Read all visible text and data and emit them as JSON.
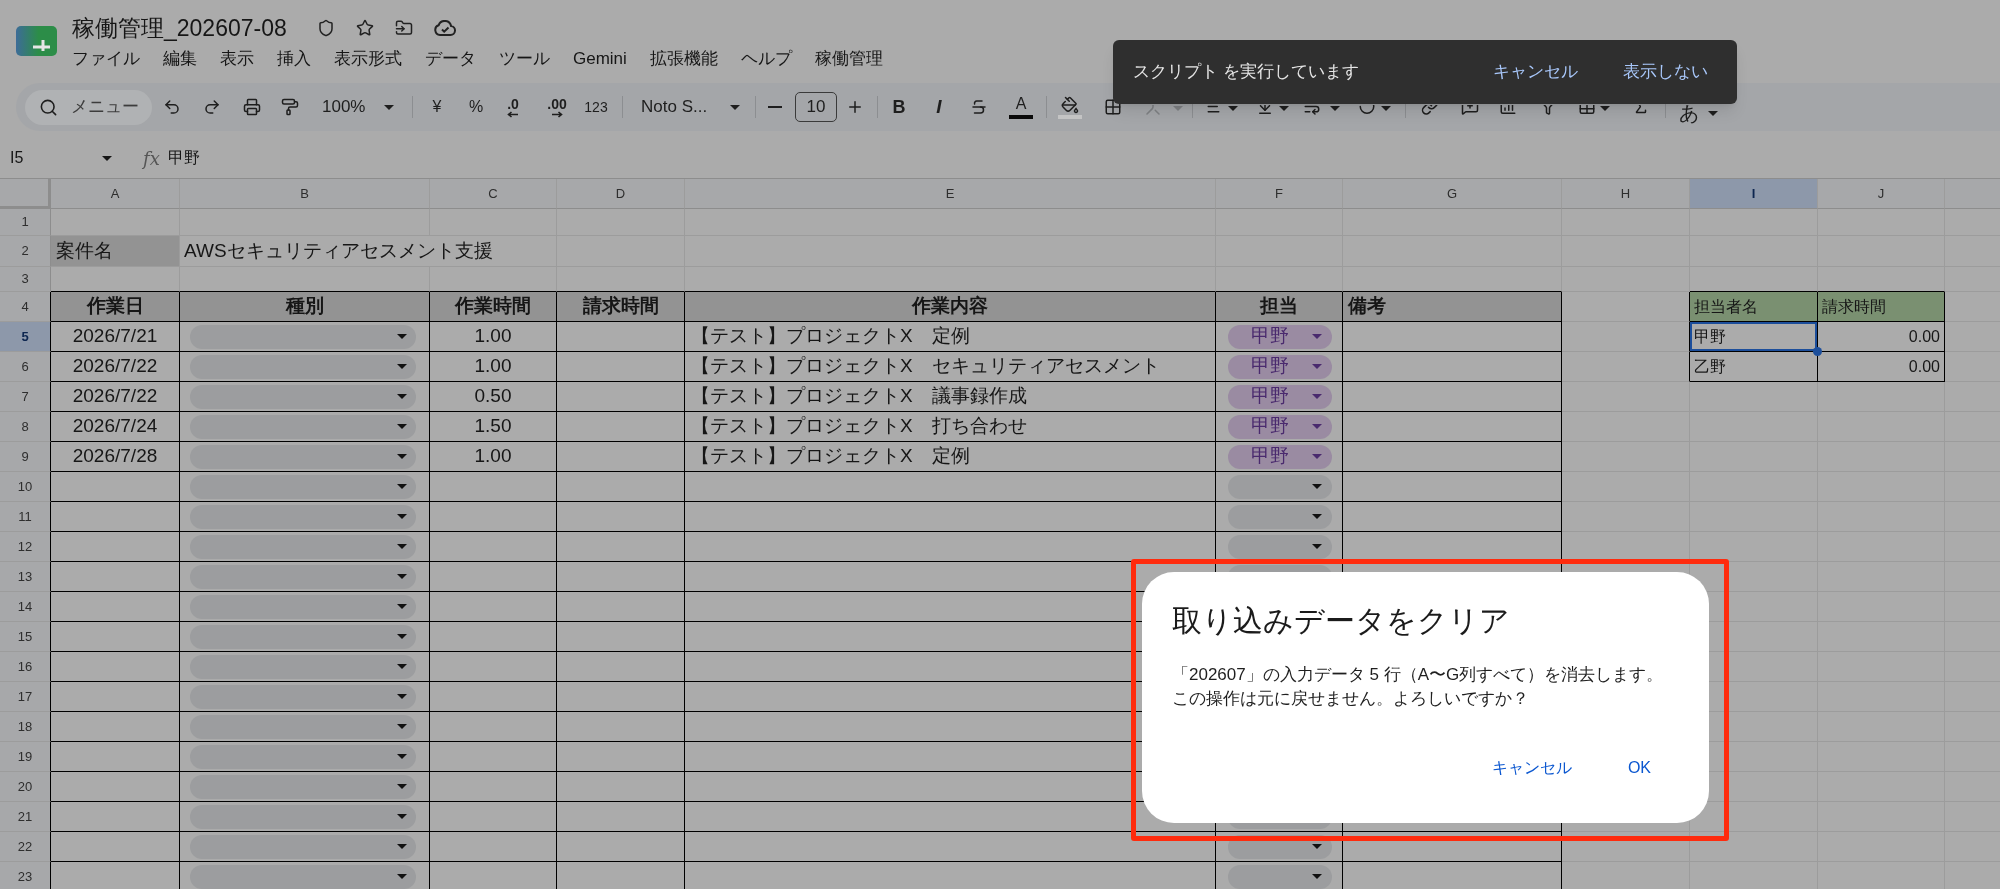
{
  "app": {
    "title": "稼働管理_202607-08",
    "menu": [
      "ファイル",
      "編集",
      "表示",
      "挿入",
      "表示形式",
      "データ",
      "ツール",
      "Gemini",
      "拡張機能",
      "ヘルプ",
      "稼働管理"
    ]
  },
  "toolbar": {
    "search": {
      "placeholder": "メニュー"
    },
    "zoom": "100%",
    "currency": "¥",
    "percent": "%",
    "decrease_decimal": ".0",
    "increase_decimal": ".00",
    "number_format": "123",
    "font": "Noto S...",
    "font_size": "10",
    "bold": "B",
    "italic": "I",
    "text_color": "A",
    "merge": {
      "disabled": true
    },
    "input_tools": "あ"
  },
  "formula_bar": {
    "cell": "I5",
    "function_label": "fx",
    "value": "甲野"
  },
  "sheet": {
    "columns": [
      {
        "label": "A",
        "selected": false
      },
      {
        "label": "B",
        "selected": false
      },
      {
        "label": "C",
        "selected": false
      },
      {
        "label": "D",
        "selected": false
      },
      {
        "label": "E",
        "selected": false
      },
      {
        "label": "F",
        "selected": false
      },
      {
        "label": "G",
        "selected": false
      },
      {
        "label": "H",
        "selected": false
      },
      {
        "label": "I",
        "selected": true
      },
      {
        "label": "J",
        "selected": false
      }
    ],
    "rows": [
      {
        "label": "1",
        "selected": false
      },
      {
        "label": "2",
        "selected": false
      },
      {
        "label": "3",
        "selected": false
      },
      {
        "label": "4",
        "selected": false
      },
      {
        "label": "5",
        "selected": true
      },
      {
        "label": "6",
        "selected": false
      },
      {
        "label": "7",
        "selected": false
      },
      {
        "label": "8",
        "selected": false
      },
      {
        "label": "9",
        "selected": false
      },
      {
        "label": "10",
        "selected": false
      },
      {
        "label": "11",
        "selected": false
      },
      {
        "label": "12",
        "selected": false
      },
      {
        "label": "13",
        "selected": false
      },
      {
        "label": "14",
        "selected": false
      },
      {
        "label": "15",
        "selected": false
      },
      {
        "label": "16",
        "selected": false
      },
      {
        "label": "17",
        "selected": false
      },
      {
        "label": "18",
        "selected": false
      },
      {
        "label": "19",
        "selected": false
      },
      {
        "label": "20",
        "selected": false
      },
      {
        "label": "21",
        "selected": false
      },
      {
        "label": "22",
        "selected": false
      },
      {
        "label": "23",
        "selected": false
      }
    ]
  },
  "project": {
    "label": "案件名",
    "value": "AWSセキュリティアセスメント支援"
  },
  "table": {
    "columns": [
      "作業日",
      "種別",
      "作業時間",
      "請求時間",
      "作業内容",
      "担当",
      "備考"
    ],
    "rows": [
      {
        "date": "2026/7/21",
        "hours": "1.00",
        "content": "【テスト】プロジェクトX　定例",
        "assignee": "甲野"
      },
      {
        "date": "2026/7/22",
        "hours": "1.00",
        "content": "【テスト】プロジェクトX　セキュリティアセスメント",
        "assignee": "甲野"
      },
      {
        "date": "2026/7/22",
        "hours": "0.50",
        "content": "【テスト】プロジェクトX　議事録作成",
        "assignee": "甲野"
      },
      {
        "date": "2026/7/24",
        "hours": "1.50",
        "content": "【テスト】プロジェクトX　打ち合わせ",
        "assignee": "甲野"
      },
      {
        "date": "2026/7/28",
        "hours": "1.00",
        "content": "【テスト】プロジェクトX　定例",
        "assignee": "甲野"
      }
    ]
  },
  "summary": {
    "columns": [
      "担当者名",
      "請求時間"
    ],
    "rows": [
      {
        "name": "甲野",
        "hours": "0.00",
        "selected": true
      },
      {
        "name": "乙野",
        "hours": "0.00",
        "selected": false
      }
    ]
  },
  "snackbar": {
    "message": "スクリプト を実行しています",
    "actions": [
      "キャンセル",
      "表示しない"
    ]
  },
  "dialog": {
    "title": "取り込みデータをクリア",
    "message": [
      "「202607」の入力データ 5 行（A〜G列すべて）を消去します。",
      "この操作は元に戻せません。よろしいですか？"
    ],
    "buttons": [
      "キャンセル",
      "OK"
    ]
  }
}
